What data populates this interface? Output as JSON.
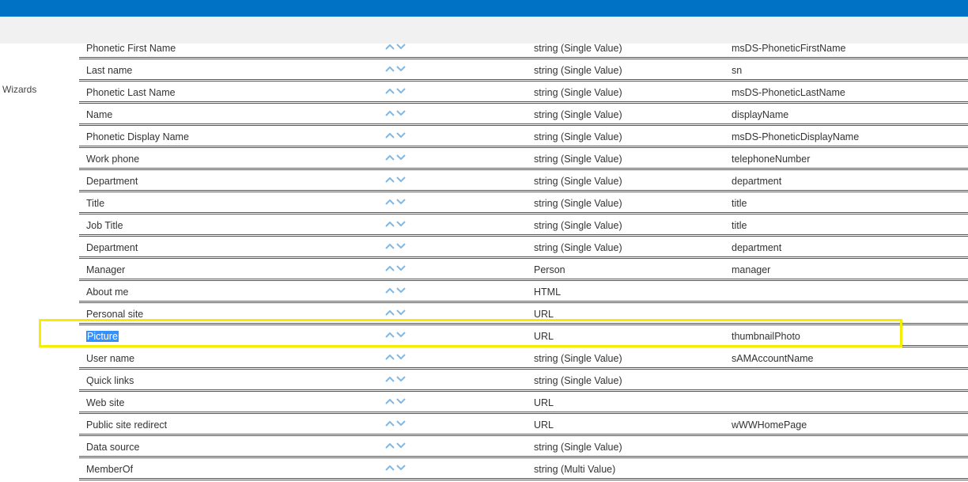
{
  "leftnav": {
    "label": "Wizards"
  },
  "colors": {
    "topbar": "#0072c6",
    "subbar": "#f1f1f1",
    "highlight": "#f5ee00",
    "selection": "#3390ff",
    "arrow": "#7fb8e6"
  },
  "rows": [
    {
      "name": "Phonetic First Name",
      "type": "string (Single Value)",
      "mapping": "msDS-PhoneticFirstName"
    },
    {
      "name": "Last name",
      "type": "string (Single Value)",
      "mapping": "sn"
    },
    {
      "name": "Phonetic Last Name",
      "type": "string (Single Value)",
      "mapping": "msDS-PhoneticLastName"
    },
    {
      "name": "Name",
      "type": "string (Single Value)",
      "mapping": "displayName"
    },
    {
      "name": "Phonetic Display Name",
      "type": "string (Single Value)",
      "mapping": "msDS-PhoneticDisplayName"
    },
    {
      "name": "Work phone",
      "type": "string (Single Value)",
      "mapping": "telephoneNumber"
    },
    {
      "name": "Department",
      "type": "string (Single Value)",
      "mapping": "department"
    },
    {
      "name": "Title",
      "type": "string (Single Value)",
      "mapping": "title"
    },
    {
      "name": "Job Title",
      "type": "string (Single Value)",
      "mapping": "title"
    },
    {
      "name": "Department",
      "type": "string (Single Value)",
      "mapping": "department"
    },
    {
      "name": "Manager",
      "type": "Person",
      "mapping": "manager"
    },
    {
      "name": "About me",
      "type": "HTML",
      "mapping": ""
    },
    {
      "name": "Personal site",
      "type": "URL",
      "mapping": ""
    },
    {
      "name": "Picture",
      "type": "URL",
      "mapping": "thumbnailPhoto"
    },
    {
      "name": "User name",
      "type": "string (Single Value)",
      "mapping": "sAMAccountName"
    },
    {
      "name": "Quick links",
      "type": "string (Single Value)",
      "mapping": ""
    },
    {
      "name": "Web site",
      "type": "URL",
      "mapping": ""
    },
    {
      "name": "Public site redirect",
      "type": "URL",
      "mapping": "wWWHomePage"
    },
    {
      "name": "Data source",
      "type": "string (Single Value)",
      "mapping": ""
    },
    {
      "name": "MemberOf",
      "type": "string (Multi Value)",
      "mapping": ""
    }
  ]
}
